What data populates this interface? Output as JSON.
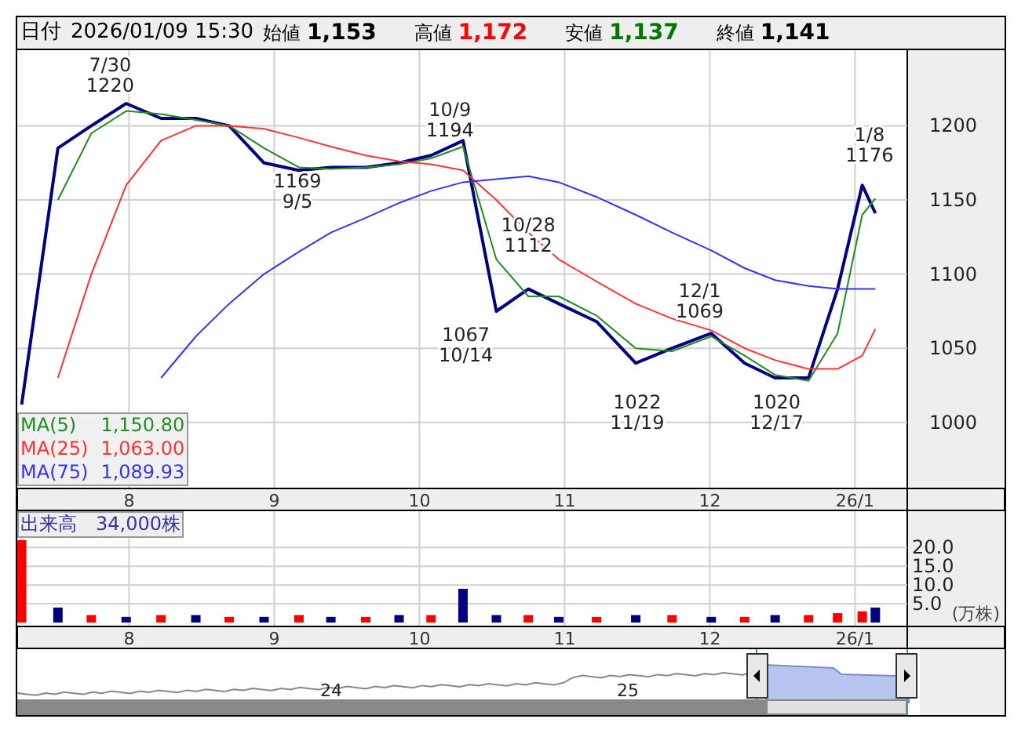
{
  "header": {
    "date_label": "日付",
    "date": "2026/01/09 15:30",
    "fields": [
      {
        "label": "始値",
        "value": "1,153",
        "color": "#000000"
      },
      {
        "label": "高値",
        "value": "1,172",
        "color": "#ff0000"
      },
      {
        "label": "安値",
        "value": "1,137",
        "color": "#007700"
      },
      {
        "label": "終値",
        "value": "1,141",
        "color": "#000000"
      }
    ]
  },
  "price_chart": {
    "legend_values": [
      "1,150.80",
      "1,063.00",
      "1,089.93"
    ],
    "chart_data": {
      "type": "line",
      "x": [
        7.26,
        7.51,
        7.74,
        7.98,
        8.22,
        8.46,
        8.69,
        8.93,
        9.17,
        9.39,
        9.63,
        9.86,
        10.08,
        10.3,
        10.53,
        10.75,
        10.96,
        11.22,
        11.49,
        11.74,
        12.01,
        12.24,
        12.45,
        12.68,
        12.88,
        13.05,
        13.14
      ],
      "xticks": [
        8,
        9,
        10,
        11,
        12,
        {
          "value": 13,
          "label": "26/1"
        }
      ],
      "xlim": [
        7.23,
        13.36
      ],
      "grid": true,
      "yticks": [
        {
          "value": 1000,
          "label": "1000"
        },
        {
          "value": 1050,
          "label": "1050"
        },
        {
          "value": 1100,
          "label": "1100"
        },
        {
          "value": 1150,
          "label": "1150"
        },
        {
          "value": 1200,
          "label": "1200"
        }
      ],
      "ylim": [
        956,
        1251
      ],
      "series": [
        {
          "color": "#000080",
          "values": [
            1012,
            1185,
            1200,
            1215,
            1205,
            1205,
            1200,
            1175,
            1170,
            1172,
            1172,
            1175,
            1180,
            1190,
            1075,
            1090,
            1080,
            1068,
            1040,
            1050,
            1060,
            1040,
            1030,
            1030,
            1090,
            1160,
            1141
          ]
        },
        {
          "name": "MA(5)",
          "color": "#228b22",
          "values": [
            null,
            1150,
            1195,
            1210,
            1208,
            1204,
            1200,
            1185,
            1172,
            1171,
            1172,
            1174,
            1178,
            1186,
            1110,
            1085,
            1085,
            1072,
            1050,
            1048,
            1058,
            1045,
            1032,
            1028,
            1060,
            1140,
            1151
          ]
        },
        {
          "name": "MA(25)",
          "color": "#ff3333",
          "values": [
            null,
            1030,
            1100,
            1160,
            1190,
            1200,
            1200,
            1198,
            1192,
            1186,
            1180,
            1176,
            1174,
            1170,
            1150,
            1128,
            1110,
            1095,
            1080,
            1070,
            1062,
            1050,
            1042,
            1036,
            1036,
            1045,
            1063
          ]
        },
        {
          "name": "MA(75)",
          "color": "#3333ff",
          "values": [
            null,
            null,
            null,
            null,
            1030,
            1058,
            1080,
            1100,
            1115,
            1128,
            1138,
            1148,
            1156,
            1162,
            1164,
            1166,
            1162,
            1152,
            1140,
            1128,
            1116,
            1104,
            1096,
            1092,
            1090,
            1090,
            1090
          ]
        }
      ],
      "annotations": [
        "7/30\n1220",
        "1169\n9/5",
        "10/9\n1194",
        "1067\n10/14",
        "10/28\n1112",
        "1022\n11/19",
        "12/1\n1069",
        "1020\n12/17",
        "1/8\n1176"
      ]
    }
  },
  "volume_chart": {
    "label": "出来高",
    "value": "34,000株",
    "unit": "(万株)",
    "chart_data": {
      "type": "bar",
      "stacked": true,
      "x": [
        7.26,
        7.51,
        7.74,
        7.98,
        8.22,
        8.46,
        8.69,
        8.93,
        9.17,
        9.39,
        9.63,
        9.86,
        10.08,
        10.3,
        10.53,
        10.75,
        10.96,
        11.22,
        11.49,
        11.74,
        12.01,
        12.24,
        12.45,
        12.68,
        12.88,
        13.05,
        13.14
      ],
      "xticks": [
        8,
        9,
        10,
        11,
        12,
        {
          "value": 13,
          "label": "26/1"
        }
      ],
      "xlim": [
        7.23,
        13.36
      ],
      "grid": true,
      "yticks": [
        {
          "value": 5,
          "label": "5.0"
        },
        {
          "value": 10,
          "label": "10.0"
        },
        {
          "value": 15,
          "label": "15.0"
        },
        {
          "value": 20,
          "label": "20.0"
        }
      ],
      "ylim": [
        0,
        23
      ],
      "series": [
        {
          "color": "#ff0000",
          "values": [
            22,
            null,
            2,
            null,
            2,
            null,
            1.5,
            null,
            2,
            null,
            1.5,
            null,
            2,
            null,
            null,
            2,
            null,
            1.5,
            null,
            2,
            null,
            1.5,
            null,
            2,
            2.5,
            3,
            null
          ]
        },
        {
          "color": "#000080",
          "values": [
            null,
            4,
            null,
            1.5,
            null,
            2,
            null,
            1.5,
            null,
            1.5,
            null,
            2,
            null,
            9,
            2,
            null,
            1.5,
            null,
            2,
            null,
            1.5,
            null,
            2,
            null,
            null,
            null,
            4
          ]
        }
      ]
    }
  },
  "navigator": {
    "year_labels": [
      "24",
      "25"
    ]
  }
}
